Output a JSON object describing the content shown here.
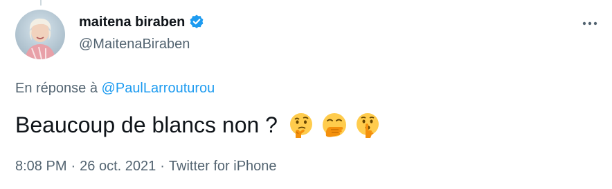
{
  "author": {
    "display_name": "maitena biraben",
    "handle": "@MaitenaBiraben",
    "verified_icon": "verified-badge-icon",
    "avatar_icon": "profile-photo"
  },
  "more_icon": "more-horizontal-icon",
  "reply": {
    "prefix": "En réponse à",
    "mention": "@PaulLarrouturou"
  },
  "tweet": {
    "text": "Beaucoup de blancs non ?",
    "emojis": [
      "thinking-face-icon",
      "face-with-hand-over-mouth-icon",
      "shushing-face-icon"
    ]
  },
  "meta": {
    "time": "8:08 PM",
    "separator": "·",
    "date": "26 oct. 2021",
    "source": "Twitter for iPhone"
  },
  "colors": {
    "link": "#1d9bf0",
    "secondary_text": "#536471",
    "primary_text": "#0f1419",
    "verified": "#1d9bf0"
  }
}
